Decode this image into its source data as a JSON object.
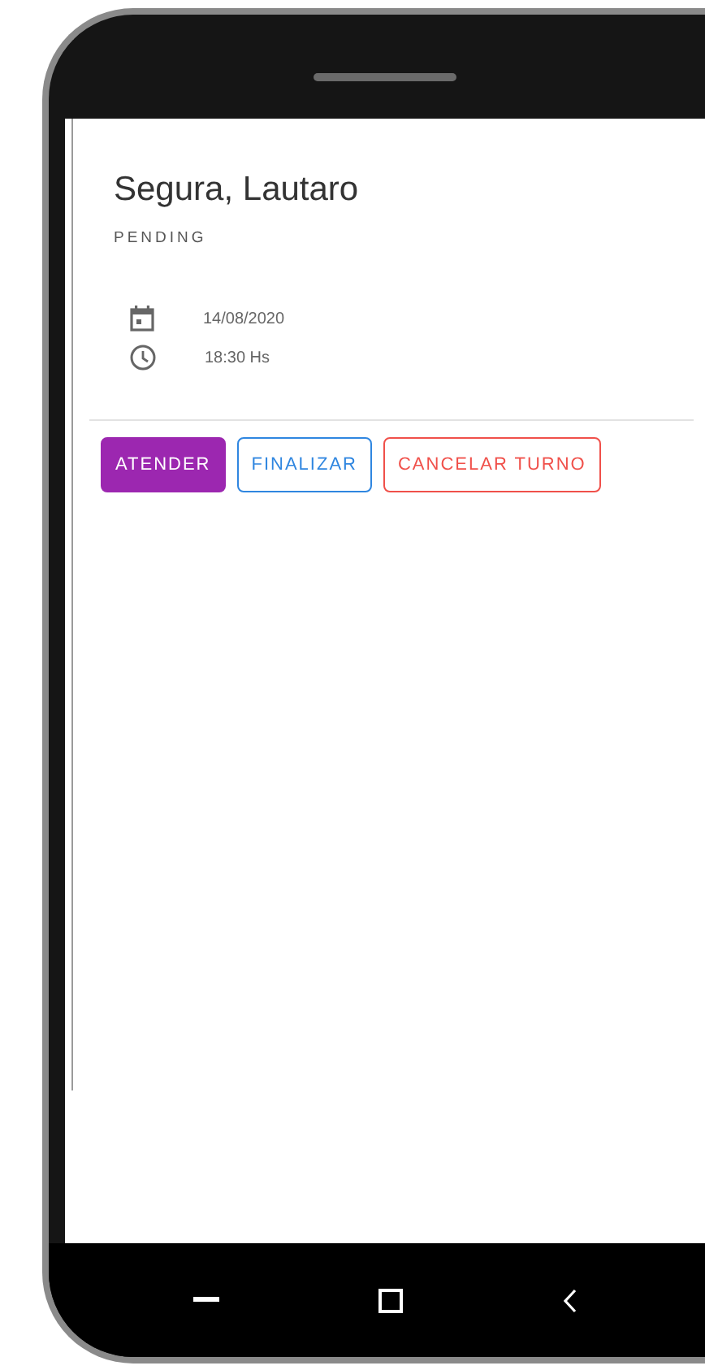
{
  "appointment": {
    "patient": "Segura, Lautaro",
    "status": "PENDING",
    "date": "14/08/2020",
    "time": "18:30 Hs"
  },
  "actions": [
    {
      "label": "ATENDER",
      "kind": "filled",
      "color": "#9c27b0"
    },
    {
      "label": "FINALIZAR",
      "kind": "outlined",
      "color": "#2f86e0"
    },
    {
      "label": "CANCELAR TURNO",
      "kind": "outlined",
      "color": "#f0504a"
    }
  ]
}
